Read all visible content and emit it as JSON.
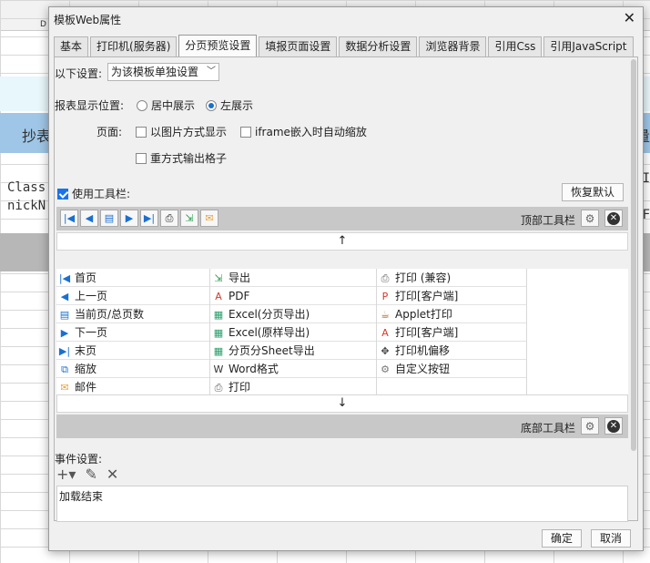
{
  "background": {
    "banner_left": "抄表",
    "banner_right": "量",
    "code_lines": [
      "Class",
      "nickN"
    ],
    "code_right": [
      "I",
      "F"
    ],
    "col_letter": "D"
  },
  "dialog": {
    "title": "模板Web属性",
    "close_glyph": "✕",
    "tabs": [
      "基本",
      "打印机(服务器)",
      "分页预览设置",
      "填报页面设置",
      "数据分析设置",
      "浏览器背景",
      "引用Css",
      "引用JavaScript"
    ],
    "active_tab": "分页预览设置",
    "settings_label": "以下设置:",
    "settings_select": "为该模板单独设置",
    "position_label": "报表显示位置:",
    "position_options": [
      "居中展示",
      "左展示"
    ],
    "position_selected": "左展示",
    "page_label": "页面:",
    "page_options": [
      "以图片方式显示",
      "iframe嵌入时自动缩放",
      "重方式输出格子"
    ],
    "use_toolbar_label": "使用工具栏:",
    "use_toolbar_checked": true,
    "restore_default": "恢复默认",
    "top_toolbar_label": "顶部工具栏",
    "bottom_toolbar_label": "底部工具栏",
    "arrow_up": "↑",
    "arrow_down": "↓",
    "buttons_col1": [
      {
        "icon": "first-page-icon",
        "glyph": "|◀",
        "label": "首页"
      },
      {
        "icon": "prev-page-icon",
        "glyph": "◀",
        "label": "上一页"
      },
      {
        "icon": "page-count-icon",
        "glyph": "▤",
        "label": "当前页/总页数"
      },
      {
        "icon": "next-page-icon",
        "glyph": "▶",
        "label": "下一页"
      },
      {
        "icon": "last-page-icon",
        "glyph": "▶|",
        "label": "末页"
      },
      {
        "icon": "zoom-icon",
        "glyph": "⧉",
        "label": "缩放"
      },
      {
        "icon": "mail-icon",
        "glyph": "✉",
        "label": "邮件"
      }
    ],
    "buttons_col2": [
      {
        "icon": "export-icon",
        "glyph": "⇲",
        "label": "导出"
      },
      {
        "icon": "pdf-icon",
        "glyph": "A",
        "label": "PDF"
      },
      {
        "icon": "excel-icon",
        "glyph": "▦",
        "label": "Excel(分页导出)"
      },
      {
        "icon": "excel-icon",
        "glyph": "▦",
        "label": "Excel(原样导出)"
      },
      {
        "icon": "excel-icon",
        "glyph": "▦",
        "label": "分页分Sheet导出"
      },
      {
        "icon": "word-icon",
        "glyph": "W",
        "label": "Word格式"
      },
      {
        "icon": "print-icon",
        "glyph": "⎙",
        "label": "打印"
      }
    ],
    "buttons_col3": [
      {
        "icon": "print-icon",
        "glyph": "⎙",
        "label": "打印 (兼容)"
      },
      {
        "icon": "pdf-print-icon",
        "glyph": "P",
        "label": "打印[客户端]"
      },
      {
        "icon": "applet-icon",
        "glyph": "☕",
        "label": "Applet打印"
      },
      {
        "icon": "pdf-icon",
        "glyph": "A",
        "label": "打印[客户端]"
      },
      {
        "icon": "move-icon",
        "glyph": "✥",
        "label": "打印机偏移"
      },
      {
        "icon": "gear-icon",
        "glyph": "⚙",
        "label": "自定义按钮"
      }
    ],
    "events_label": "事件设置:",
    "event_items": [
      "加载结束"
    ],
    "ok_label": "确定",
    "cancel_label": "取消"
  }
}
